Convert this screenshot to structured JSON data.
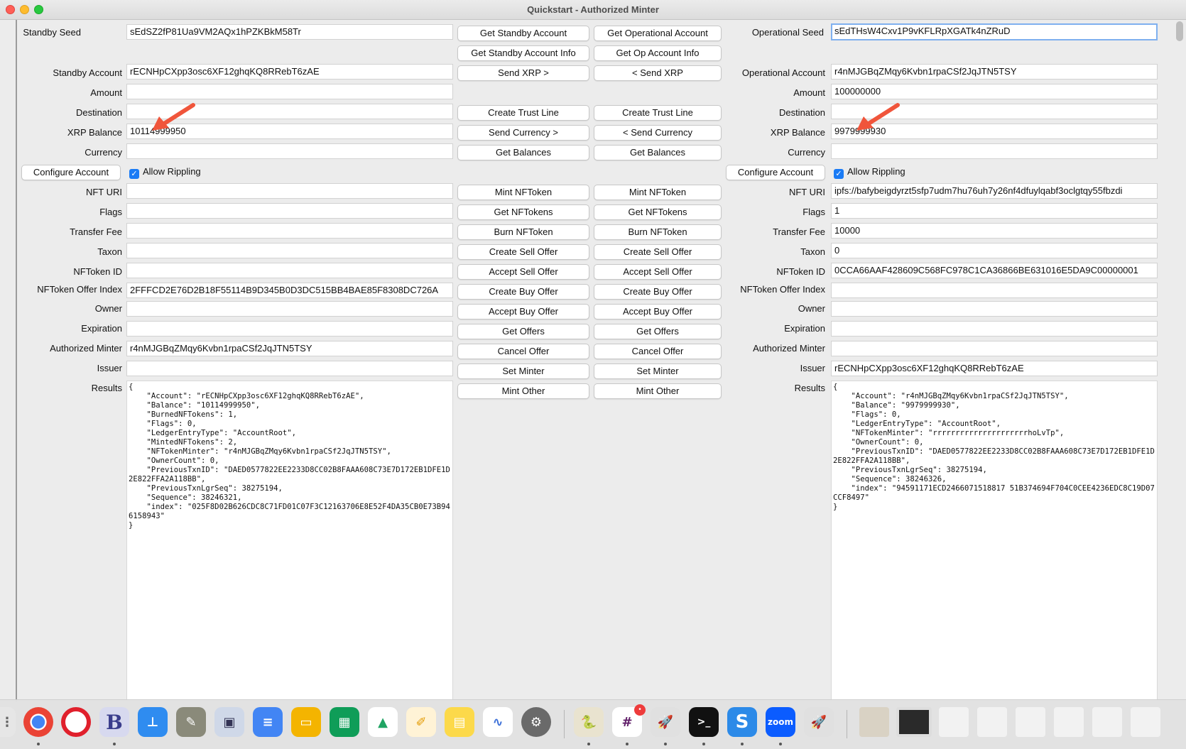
{
  "window": {
    "title": "Quickstart - Authorized Minter"
  },
  "standby": {
    "seed_label": "Standby Seed",
    "seed_value": "sEdSZ2fP81Ua9VM2AQx1hPZKBkM58Tr",
    "account_label": "Standby Account",
    "account_value": "rECNHpCXpp3osc6XF12ghqKQ8RRebT6zAE",
    "amount_label": "Amount",
    "amount_value": "",
    "destination_label": "Destination",
    "destination_value": "",
    "xrp_balance_label": "XRP Balance",
    "xrp_balance_value": "10114999950",
    "currency_label": "Currency",
    "currency_value": "",
    "configure_button": "Configure Account",
    "allow_rippling_label": "Allow Rippling",
    "nft_uri_label": "NFT URI",
    "nft_uri_value": "",
    "flags_label": "Flags",
    "flags_value": "",
    "transfer_fee_label": "Transfer Fee",
    "transfer_fee_value": "",
    "taxon_label": "Taxon",
    "taxon_value": "",
    "nftoken_id_label": "NFToken ID",
    "nftoken_id_value": "",
    "offer_index_label": "NFToken Offer Index",
    "offer_index_value": "2FFFCD2E76D2B18F55114B9D345B0D3DC515BB4BAE85F8308DC726A",
    "owner_label": "Owner",
    "owner_value": "",
    "expiration_label": "Expiration",
    "expiration_value": "",
    "authorized_minter_label": "Authorized Minter",
    "authorized_minter_value": "r4nMJGBqZMqy6Kvbn1rpaCSf2JqJTN5TSY",
    "issuer_label": "Issuer",
    "issuer_value": "",
    "results_label": "Results",
    "results_value": "{\n    \"Account\": \"rECNHpCXpp3osc6XF12ghqKQ8RRebT6zAE\",\n    \"Balance\": \"10114999950\",\n    \"BurnedNFTokens\": 1,\n    \"Flags\": 0,\n    \"LedgerEntryType\": \"AccountRoot\",\n    \"MintedNFTokens\": 2,\n    \"NFTokenMinter\": \"r4nMJGBqZMqy6Kvbn1rpaCSf2JqJTN5TSY\",\n    \"OwnerCount\": 0,\n    \"PreviousTxnID\": \"DAED0577822EE2233D8CC02B8FAAA608C73E7D172EB1DFE1D2E822FFA2A118BB\",\n    \"PreviousTxnLgrSeq\": 38275194,\n    \"Sequence\": 38246321,\n    \"index\": \"025F8D02B626CDC8C71FD01C07F3C12163706E8E52F4DA35CB0E73B946158943\"\n}"
  },
  "operational": {
    "seed_label": "Operational Seed",
    "seed_value": "sEdTHsW4Cxv1P9vKFLRpXGATk4nZRuD",
    "account_label": "Operational Account",
    "account_value": "r4nMJGBqZMqy6Kvbn1rpaCSf2JqJTN5TSY",
    "amount_label": "Amount",
    "amount_value": "100000000",
    "destination_label": "Destination",
    "destination_value": "",
    "xrp_balance_label": "XRP Balance",
    "xrp_balance_value": "9979999930",
    "currency_label": "Currency",
    "currency_value": "",
    "configure_button": "Configure Account",
    "allow_rippling_label": "Allow Rippling",
    "nft_uri_label": "NFT URI",
    "nft_uri_value": "ipfs://bafybeigdyrzt5sfp7udm7hu76uh7y26nf4dfuylqabf3oclgtqy55fbzdi",
    "flags_label": "Flags",
    "flags_value": "1",
    "transfer_fee_label": "Transfer Fee",
    "transfer_fee_value": "10000",
    "taxon_label": "Taxon",
    "taxon_value": "0",
    "nftoken_id_label": "NFToken ID",
    "nftoken_id_value": "0CCA66AAF428609C568FC978C1CA36866BE631016E5DA9C00000001",
    "offer_index_label": "NFToken Offer Index",
    "offer_index_value": "",
    "owner_label": "Owner",
    "owner_value": "",
    "expiration_label": "Expiration",
    "expiration_value": "",
    "authorized_minter_label": "Authorized Minter",
    "authorized_minter_value": "",
    "issuer_label": "Issuer",
    "issuer_value": "rECNHpCXpp3osc6XF12ghqKQ8RRebT6zAE",
    "results_label": "Results",
    "results_value": "{\n    \"Account\": \"r4nMJGBqZMqy6Kvbn1rpaCSf2JqJTN5TSY\",\n    \"Balance\": \"9979999930\",\n    \"Flags\": 0,\n    \"LedgerEntryType\": \"AccountRoot\",\n    \"NFTokenMinter\": \"rrrrrrrrrrrrrrrrrrrrrhoLvTp\",\n    \"OwnerCount\": 0,\n    \"PreviousTxnID\": \"DAED0577822EE2233D8CC02B8FAAA608C73E7D172EB1DFE1D2E822FFA2A118BB\",\n    \"PreviousTxnLgrSeq\": 38275194,\n    \"Sequence\": 38246326,\n    \"index\": \"94591171ECD2466071518817 51B374694F704C0CEE4236EDC8C19D07CCF8497\"\n}"
  },
  "buttons": {
    "standby": {
      "get_account": "Get Standby Account",
      "get_account_info": "Get Standby Account Info",
      "send_xrp": "Send XRP >",
      "create_trust_line": "Create Trust Line",
      "send_currency": "Send Currency >",
      "get_balances": "Get Balances",
      "mint_nftoken": "Mint NFToken",
      "get_nftokens": "Get NFTokens",
      "burn_nftoken": "Burn NFToken",
      "create_sell_offer": "Create Sell Offer",
      "accept_sell_offer": "Accept Sell Offer",
      "create_buy_offer": "Create Buy Offer",
      "accept_buy_offer": "Accept Buy Offer",
      "get_offers": "Get Offers",
      "cancel_offer": "Cancel Offer",
      "set_minter": "Set Minter",
      "mint_other": "Mint Other"
    },
    "operational": {
      "get_account": "Get Operational Account",
      "get_account_info": "Get Op Account Info",
      "send_xrp": "< Send XRP",
      "create_trust_line": "Create Trust Line",
      "send_currency": "< Send Currency",
      "get_balances": "Get Balances",
      "mint_nftoken": "Mint NFToken",
      "get_nftokens": "Get NFTokens",
      "burn_nftoken": "Burn NFToken",
      "create_sell_offer": "Create Sell Offer",
      "accept_sell_offer": "Accept Sell Offer",
      "create_buy_offer": "Create Buy Offer",
      "accept_buy_offer": "Accept Buy Offer",
      "get_offers": "Get Offers",
      "cancel_offer": "Cancel Offer",
      "set_minter": "Set Minter",
      "mint_other": "Mint Other"
    }
  },
  "colors": {
    "annotation_arrow": "#f0553b",
    "checkbox": "#1a7bf5"
  },
  "dock": {
    "apps": [
      "launchpad-icon",
      "chrome-icon",
      "opera-icon",
      "bbedit-icon",
      "keynote-icon",
      "gimp-icon",
      "preview-icon",
      "docs-icon",
      "slides-icon",
      "sheets-icon",
      "drive-icon",
      "pages-icon",
      "notes-icon",
      "freeform-icon",
      "system-settings-icon",
      "python-launcher-icon",
      "slack-icon",
      "rocket-icon",
      "terminal-icon",
      "scrivener-icon",
      "zoom-icon",
      "rocket-icon-2"
    ],
    "zoom_label": "zoom",
    "slack_badge": "•"
  }
}
